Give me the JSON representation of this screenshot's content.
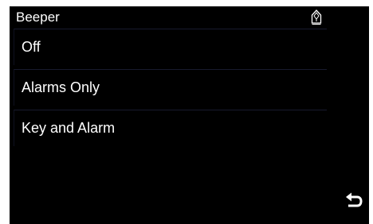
{
  "header": {
    "title": "Beeper",
    "status_icon": "pump-lock-icon"
  },
  "menu": {
    "items": [
      {
        "label": "Off"
      },
      {
        "label": "Alarms Only"
      },
      {
        "label": "Key and Alarm"
      }
    ]
  },
  "footer": {
    "back_icon": "back-arrow-icon"
  },
  "colors": {
    "background": "#000000",
    "text": "#ffffff",
    "divider": "#181a2e"
  }
}
